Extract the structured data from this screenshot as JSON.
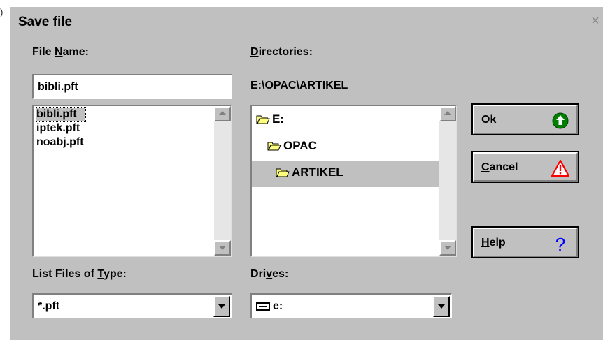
{
  "window": {
    "title": "Save file",
    "close_glyph": "×"
  },
  "file_name": {
    "label_prefix": "File ",
    "label_mnemonic": "N",
    "label_suffix": "ame:",
    "value": "bibli.pft",
    "files": [
      "bibli.pft",
      "iptek.pft",
      "noabj.pft"
    ],
    "selected_index": 0
  },
  "directories": {
    "label_mnemonic": "D",
    "label_suffix": "irectories:",
    "current_path": "E:\\OPAC\\ARTIKEL",
    "tree": [
      {
        "name": "E:",
        "icon": "open-folder-icon"
      },
      {
        "name": "OPAC",
        "icon": "open-folder-icon"
      },
      {
        "name": "ARTIKEL",
        "icon": "open-folder-icon",
        "selected": true
      }
    ]
  },
  "file_type": {
    "label_prefix": "List Files of ",
    "label_mnemonic": "T",
    "label_suffix": "ype:",
    "value": "*.pft"
  },
  "drives": {
    "label_prefix": "Dri",
    "label_mnemonic": "v",
    "label_suffix": "es:",
    "value": "e:",
    "icon": "drive-icon"
  },
  "buttons": {
    "ok": {
      "mnemonic": "O",
      "rest": "k",
      "icon": "green-up-arrow-icon",
      "icon_color": "#008000"
    },
    "cancel": {
      "mnemonic": "C",
      "rest": "ancel",
      "icon": "warning-triangle-icon",
      "icon_color": "#ff0000"
    },
    "help": {
      "mnemonic": "H",
      "rest": "elp",
      "icon": "question-mark-icon",
      "icon_color": "#0000ff"
    }
  },
  "colors": {
    "face": "#c0c0c0",
    "shadow": "#808080",
    "highlight": "#ffffff"
  }
}
